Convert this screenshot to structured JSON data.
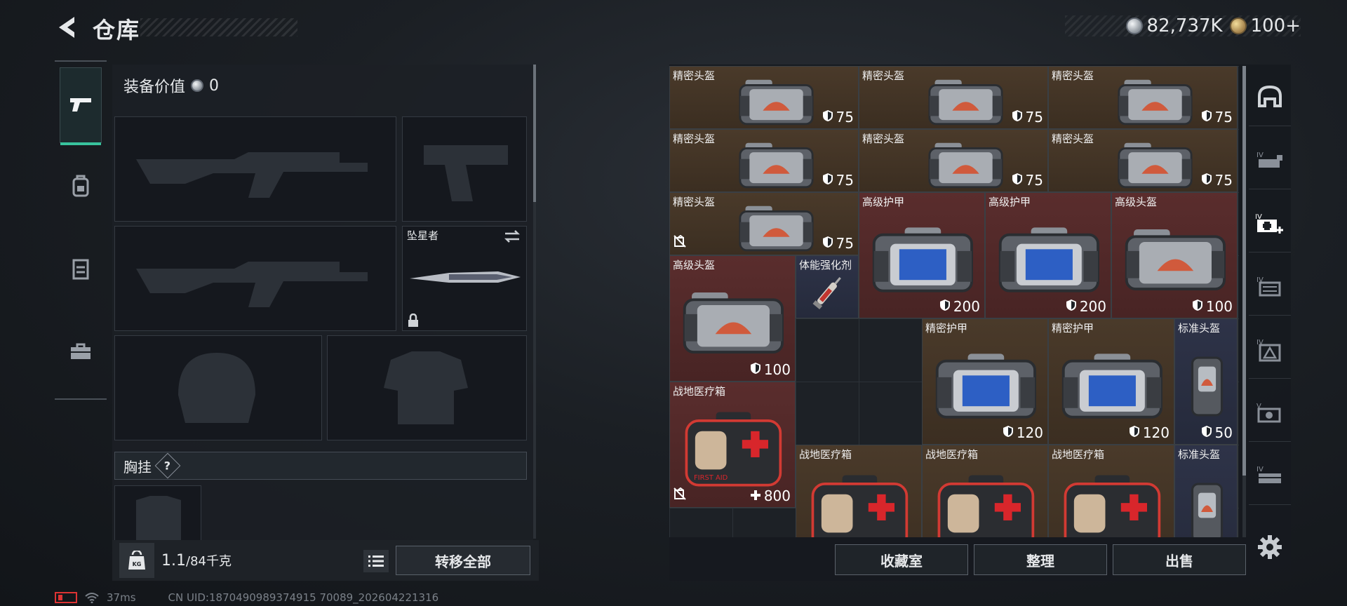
{
  "header": {
    "title": "仓库",
    "currency": {
      "silver": "82,737K",
      "gold": "100+"
    }
  },
  "loadout": {
    "tabs": [
      {
        "icon": "pistol-icon",
        "active": true
      },
      {
        "icon": "backpack-icon",
        "active": false
      },
      {
        "icon": "vest-icon",
        "active": false
      },
      {
        "icon": "toolbox-icon",
        "active": false
      }
    ],
    "equip_value_label": "装备价值",
    "equip_value": "0",
    "melee_name": "坠星者",
    "chest_rig_label": "胸挂",
    "chest_rig_help": "?",
    "weight_current": "1.1",
    "weight_max": "/84千克",
    "weight_icon_text": "KG",
    "transfer_all": "转移全部"
  },
  "storage": {
    "items": [
      {
        "name": "精密头盔",
        "value": "75",
        "type": "armor",
        "bg": "brown",
        "art": "bag"
      },
      {
        "name": "精密头盔",
        "value": "75",
        "type": "armor",
        "bg": "brown",
        "art": "bag"
      },
      {
        "name": "精密头盔",
        "value": "75",
        "type": "armor",
        "bg": "brown",
        "art": "bag"
      },
      {
        "name": "精密头盔",
        "value": "75",
        "type": "armor",
        "bg": "brown",
        "art": "bag"
      },
      {
        "name": "精密头盔",
        "value": "75",
        "type": "armor",
        "bg": "brown",
        "art": "bag"
      },
      {
        "name": "精密头盔",
        "value": "75",
        "type": "armor",
        "bg": "brown",
        "art": "bag"
      },
      {
        "name": "精密头盔",
        "value": "75",
        "type": "armor",
        "bg": "brown",
        "art": "bag",
        "no_trade": true
      },
      {
        "name": "高级护甲",
        "value": "200",
        "type": "armor",
        "bg": "red",
        "art": "bag-blue"
      },
      {
        "name": "高级护甲",
        "value": "200",
        "type": "armor",
        "bg": "red",
        "art": "bag-blue"
      },
      {
        "name": "高级头盔",
        "value": "100",
        "type": "armor",
        "bg": "red",
        "art": "bag"
      },
      {
        "name": "高级头盔",
        "value": "100",
        "type": "armor",
        "bg": "red",
        "art": "bag"
      },
      {
        "name": "体能强化剂",
        "value": "",
        "type": "none",
        "bg": "blue",
        "art": "syringe"
      },
      {
        "name": "精密护甲",
        "value": "120",
        "type": "armor",
        "bg": "brown",
        "art": "bag-blue"
      },
      {
        "name": "精密护甲",
        "value": "120",
        "type": "armor",
        "bg": "brown",
        "art": "bag-blue"
      },
      {
        "name": "标准头盔",
        "value": "50",
        "type": "armor",
        "bg": "blue",
        "art": "vest"
      },
      {
        "name": "战地医疗箱",
        "value": "800",
        "type": "heal",
        "bg": "red",
        "art": "medkit",
        "no_trade": true
      },
      {
        "name": "战地医疗箱",
        "value": "",
        "type": "none",
        "bg": "brown",
        "art": "medkit"
      },
      {
        "name": "战地医疗箱",
        "value": "",
        "type": "none",
        "bg": "brown",
        "art": "medkit"
      },
      {
        "name": "战地医疗箱",
        "value": "",
        "type": "none",
        "bg": "brown",
        "art": "medkit"
      },
      {
        "name": "标准头盔",
        "value": "",
        "type": "none",
        "bg": "blue",
        "art": "vest"
      }
    ],
    "categories": [
      "helmet-icon",
      "case-icon",
      "medical-icon",
      "folder-icon",
      "tag-icon",
      "gear-case-icon",
      "box-icon"
    ],
    "buttons": {
      "collection": "收藏室",
      "organize": "整理",
      "sell": "出售"
    }
  },
  "status": {
    "ping": "37ms",
    "uid": "CN UID:1870490989374915 70089_202604221316"
  },
  "colors": {
    "accent": "#38c39d",
    "tile_brown": "#4a3a2a",
    "tile_red": "#5a2d2d",
    "tile_blue": "#2e3348"
  }
}
